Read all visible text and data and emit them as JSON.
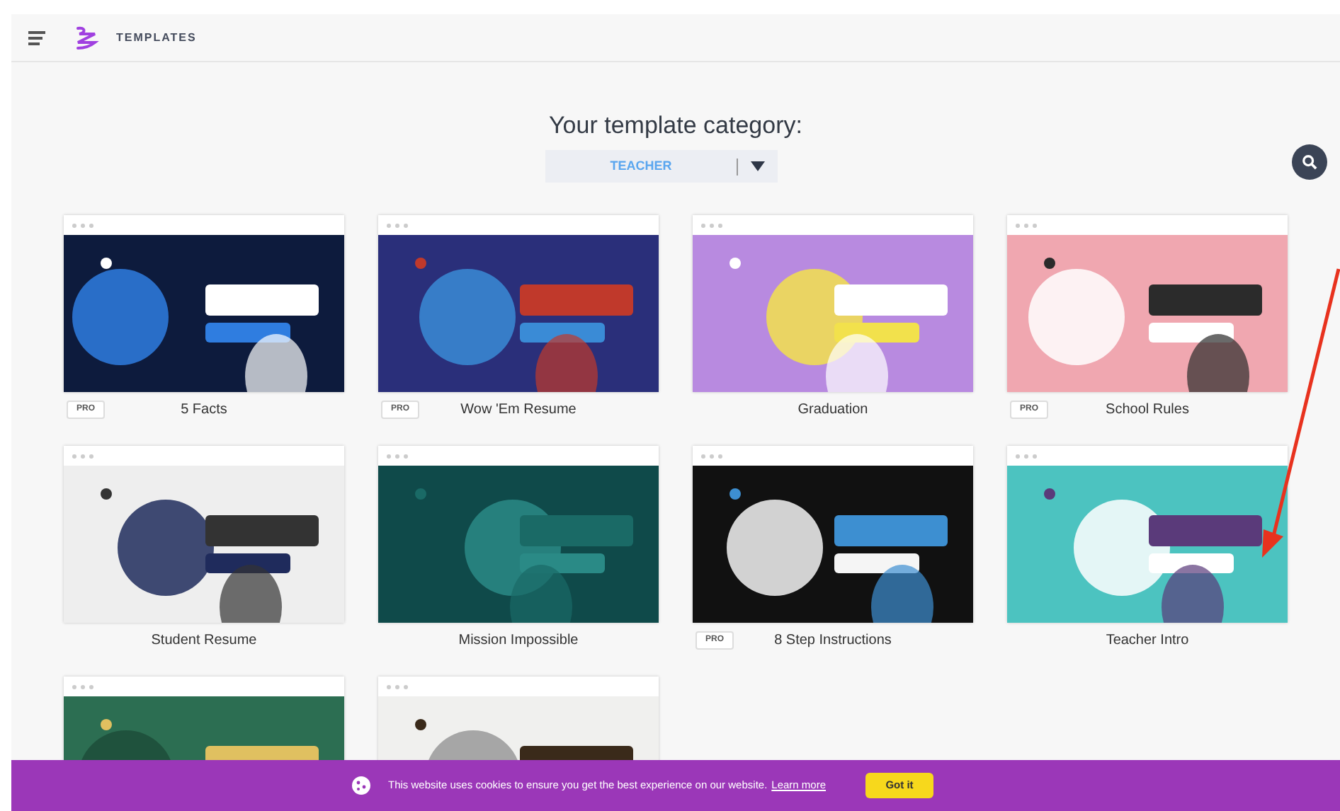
{
  "header": {
    "title": "TEMPLATES"
  },
  "category": {
    "heading": "Your template category:",
    "value": "TEACHER"
  },
  "templates": [
    {
      "kind": "picture",
      "title": "5 Facts",
      "badge": "PRO"
    },
    {
      "kind": "picture",
      "title": "Wow 'Em Resume",
      "badge": "PRO"
    },
    {
      "kind": "picture",
      "title": "Graduation"
    },
    {
      "kind": "picture",
      "title": "School Rules",
      "badge": "PRO"
    },
    {
      "kind": "picture",
      "title": "Student Resume"
    },
    {
      "kind": "picture",
      "title": "Mission Impossible"
    },
    {
      "kind": "picture",
      "title": "8 Step Instructions",
      "badge": "PRO"
    },
    {
      "kind": "picture",
      "title": "Teacher Intro"
    },
    {
      "kind": "picture"
    },
    {
      "kind": "picture"
    }
  ],
  "cookie_banner": {
    "text": "This website uses cookies to ensure you get the best experience on our website.",
    "link": "Learn more",
    "button": "Got it"
  }
}
